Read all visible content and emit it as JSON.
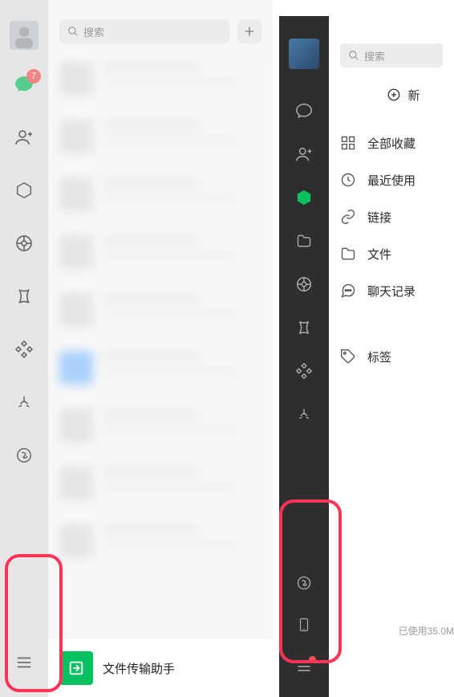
{
  "left": {
    "search_placeholder": "搜索",
    "chat_badge": "7",
    "pinned_label": "文件传输助手"
  },
  "right": {
    "search_placeholder": "搜索",
    "new_button": "新",
    "categories": {
      "all": "全部收藏",
      "recent": "最近使用",
      "links": "链接",
      "files": "文件",
      "chatlog": "聊天记录",
      "tags": "标签"
    },
    "storage_text": "已使用35.0M"
  }
}
